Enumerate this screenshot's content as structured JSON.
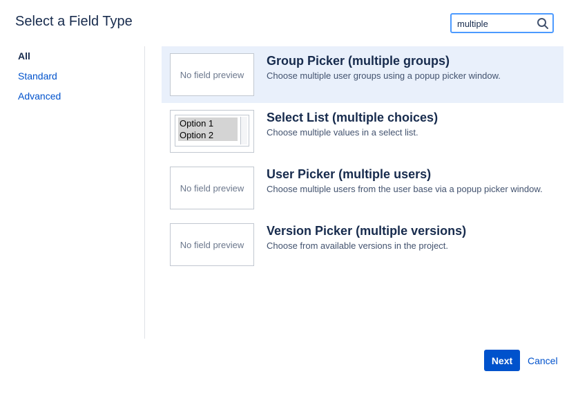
{
  "dialog": {
    "title": "Select a Field Type"
  },
  "search": {
    "value": "multiple",
    "icon": "search-icon"
  },
  "sidebar": {
    "items": [
      {
        "label": "All",
        "active": true
      },
      {
        "label": "Standard",
        "active": false
      },
      {
        "label": "Advanced",
        "active": false
      }
    ]
  },
  "fields": [
    {
      "name": "Group Picker (multiple groups)",
      "description": "Choose multiple user groups using a popup picker window.",
      "preview": "No field preview",
      "selected": true
    },
    {
      "name": "Select List (multiple choices)",
      "description": "Choose multiple values in a select list.",
      "preview_options": [
        "Option 1",
        "Option 2"
      ],
      "selected": false
    },
    {
      "name": "User Picker (multiple users)",
      "description": "Choose multiple users from the user base via a popup picker window.",
      "preview": "No field preview",
      "selected": false
    },
    {
      "name": "Version Picker (multiple versions)",
      "description": "Choose from available versions in the project.",
      "preview": "No field preview",
      "selected": false
    }
  ],
  "footer": {
    "next_label": "Next",
    "cancel_label": "Cancel"
  },
  "colors": {
    "accent": "#0052cc",
    "selected_row": "#e9f0fb",
    "focus_border": "#4c9aff",
    "text": "#172b4d"
  }
}
